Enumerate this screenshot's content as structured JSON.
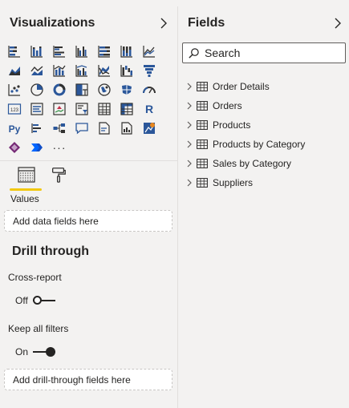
{
  "visualizations": {
    "title": "Visualizations",
    "icons": [
      [
        "stacked-bar-chart-icon",
        "stacked-column-chart-icon",
        "clustered-bar-chart-icon",
        "clustered-column-chart-icon",
        "100-stacked-bar-chart-icon",
        "100-stacked-column-chart-icon",
        "line-chart-icon"
      ],
      [
        "area-chart-icon",
        "stacked-area-chart-icon",
        "line-and-stacked-column-chart-icon",
        "line-and-clustered-column-chart-icon",
        "ribbon-chart-icon",
        "waterfall-chart-icon",
        "funnel-chart-icon"
      ],
      [
        "scatter-chart-icon",
        "pie-chart-icon",
        "donut-chart-icon",
        "treemap-icon",
        "map-icon",
        "filled-map-icon",
        "gauge-icon"
      ],
      [
        "card-icon",
        "multi-row-card-icon",
        "kpi-icon",
        "slicer-icon",
        "table-icon",
        "matrix-icon",
        "r-script-visual-icon"
      ],
      [
        "python-visual-icon",
        "key-influencers-icon",
        "decomposition-tree-icon",
        "qa-visual-icon",
        "smart-narrative-icon",
        "paginated-report-icon",
        "arcgis-map-icon"
      ],
      [
        "power-apps-icon",
        "power-automate-icon",
        "more-visuals-icon"
      ]
    ],
    "more_label": "···"
  },
  "build": {
    "values_label": "Values",
    "values_well": "Add data fields here",
    "drill_title": "Drill through",
    "cross_report_label": "Cross-report",
    "cross_report_state": "Off",
    "keep_filters_label": "Keep all filters",
    "keep_filters_state": "On",
    "drill_well": "Add drill-through fields here"
  },
  "fields": {
    "title": "Fields",
    "search_placeholder": "Search",
    "tables": [
      "Order Details",
      "Orders",
      "Products",
      "Products by Category",
      "Sales by Category",
      "Suppliers"
    ]
  },
  "colors": {
    "accent_yellow": "#f2c811",
    "icon_blue": "#2b579a",
    "icon_dark": "#323130"
  }
}
